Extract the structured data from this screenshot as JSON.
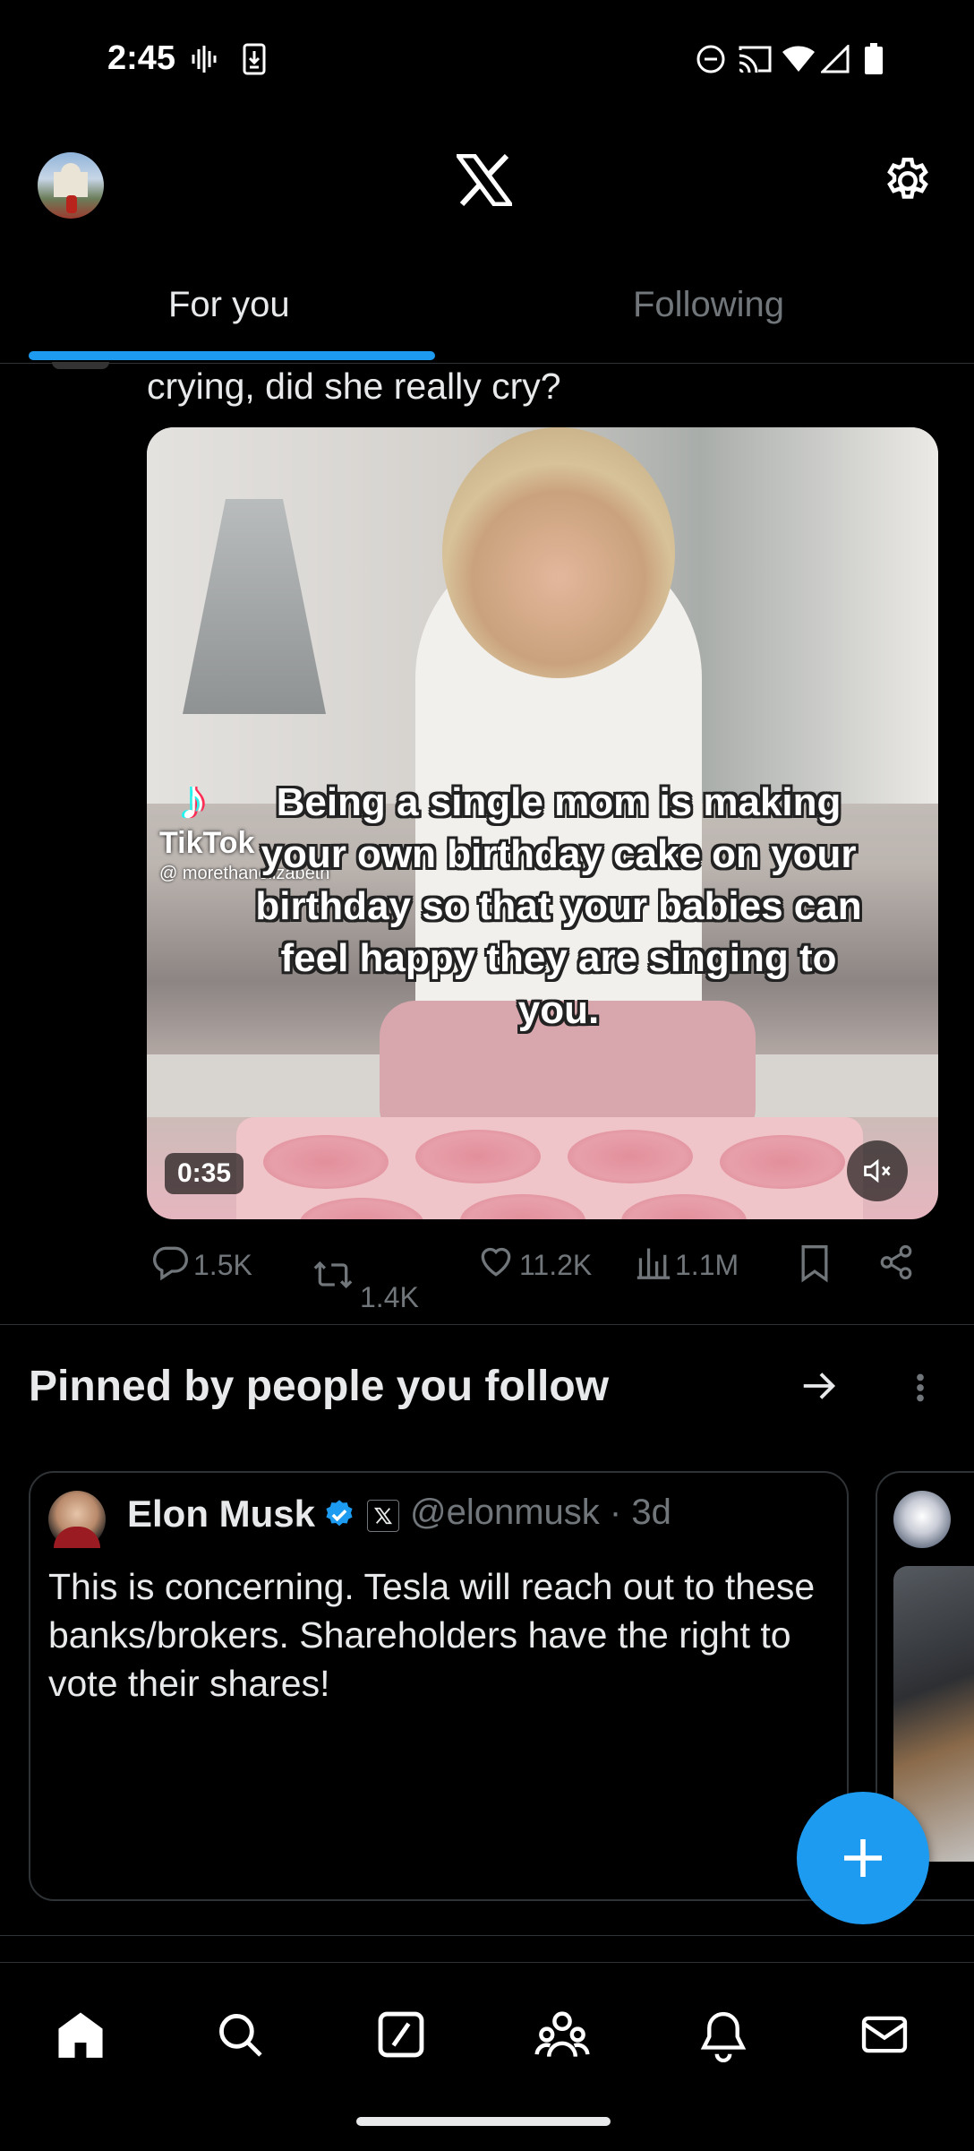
{
  "status_bar": {
    "time": "2:45",
    "icons": [
      "voicemail-icon",
      "download-icon",
      "dnd-icon",
      "cast-icon",
      "wifi-icon",
      "signal-icon",
      "battery-icon"
    ]
  },
  "header": {
    "logo": "𝕏",
    "settings_icon": "gear-icon"
  },
  "tabs": [
    {
      "label": "For you",
      "active": true
    },
    {
      "label": "Following",
      "active": false
    }
  ],
  "tweet": {
    "text": "crying, did she really cry?",
    "video": {
      "duration": "0:35",
      "caption": "Being a single mom is making your own birthday cake on your birthday so that your babies can feel happy they are singing to you.",
      "watermark": "TikTok",
      "watermark_handle": "@ morethanelizabeth"
    },
    "actions": {
      "replies": "1.5K",
      "reposts": "1.4K",
      "likes": "11.2K",
      "views": "1.1M"
    }
  },
  "pinned": {
    "title": "Pinned by people you follow",
    "card": {
      "name": "Elon Musk",
      "handle_time": "@elonmusk · 3d",
      "text": "This is concerning. Tesla will reach out to these banks/brokers. Shareholders have the right to vote their shares!"
    }
  },
  "colors": {
    "accent": "#1d9bf0",
    "text": "#e7e9ea",
    "muted": "#71767b",
    "border": "#2f3336"
  },
  "bottom_nav": [
    "home-icon",
    "search-icon",
    "grok-icon",
    "communities-icon",
    "notifications-icon",
    "messages-icon"
  ]
}
